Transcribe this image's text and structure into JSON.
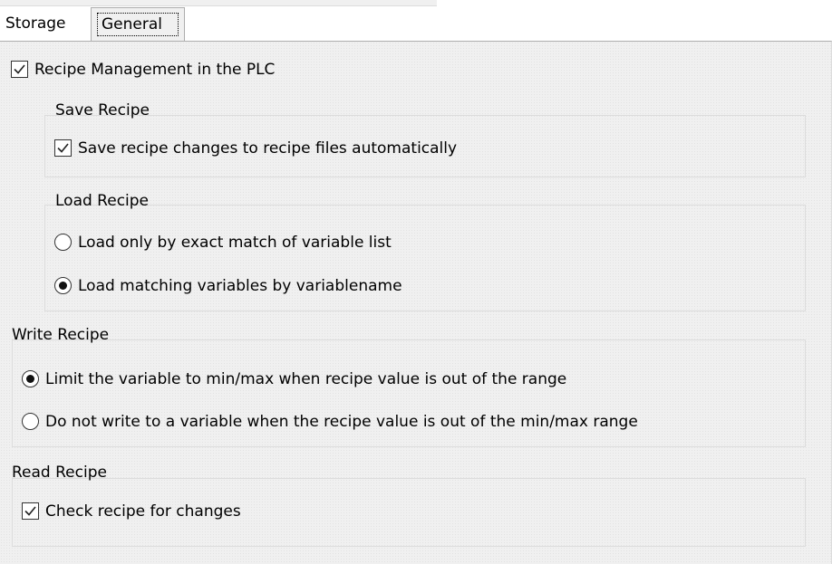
{
  "tabs": [
    {
      "label": "Storage"
    },
    {
      "label": "General"
    }
  ],
  "recipe_management": {
    "label": "Recipe Management in the PLC",
    "checked": true
  },
  "save_recipe": {
    "title": "Save Recipe",
    "auto_save": {
      "label": "Save recipe changes to recipe files automatically",
      "checked": true
    }
  },
  "load_recipe": {
    "title": "Load Recipe",
    "options": [
      {
        "label": "Load only by exact match of variable list",
        "selected": false
      },
      {
        "label": "Load matching variables by variablename",
        "selected": true
      }
    ]
  },
  "write_recipe": {
    "title": "Write Recipe",
    "options": [
      {
        "label": "Limit the variable to min/max when recipe value is out of the range",
        "selected": true
      },
      {
        "label": "Do not write to a variable when the recipe value is out of the min/max range",
        "selected": false
      }
    ]
  },
  "read_recipe": {
    "title": "Read Recipe",
    "check_changes": {
      "label": "Check recipe for changes",
      "checked": true
    }
  }
}
